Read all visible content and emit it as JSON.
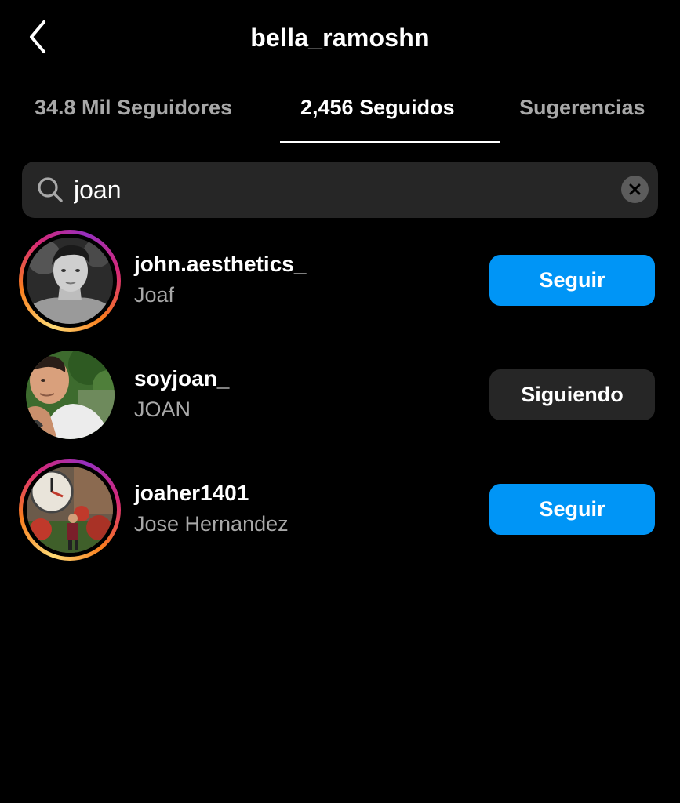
{
  "header": {
    "title": "bella_ramoshn",
    "back_icon": "chevron-left-icon"
  },
  "tabs": [
    {
      "label": "34.8 Mil Seguidores",
      "active": false
    },
    {
      "label": "2,456 Seguidos",
      "active": true
    },
    {
      "label": "Sugerencias",
      "active": false
    }
  ],
  "search": {
    "value": "joan",
    "icon": "search-icon",
    "clear_icon": "clear-icon"
  },
  "results": [
    {
      "username": "john.aesthetics_",
      "full_name": "Joaf",
      "button": "Seguir",
      "has_story": true
    },
    {
      "username": "soyjoan_",
      "full_name": "JOAN",
      "button": "Siguiendo",
      "has_story": false
    },
    {
      "username": "joaher1401",
      "full_name": "Jose Hernandez",
      "button": "Seguir",
      "has_story": true
    }
  ],
  "colors": {
    "accent": "#0095f6",
    "background": "#000000",
    "surface": "#262626",
    "secondary_text": "#a8a8a8"
  }
}
